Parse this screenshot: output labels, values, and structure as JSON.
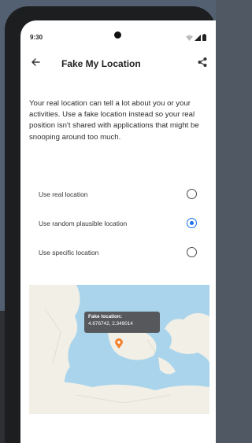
{
  "status": {
    "time": "9:30"
  },
  "app_bar": {
    "title": "Fake My Location"
  },
  "description": "Your real location can tell a lot about you or your activities. Use a fake location instead so your real position isn't shared with applications that might be snooping around too much.",
  "options": [
    {
      "label": "Use real location",
      "checked": false
    },
    {
      "label": "Use random plausible location",
      "checked": true
    },
    {
      "label": "Use specific location",
      "checked": false
    }
  ],
  "map": {
    "tooltip_title": "Fake location:",
    "tooltip_coords": "4.676742, 2.349014",
    "pin_color": "#f2822e"
  },
  "colors": {
    "accent": "#1a73e8"
  }
}
